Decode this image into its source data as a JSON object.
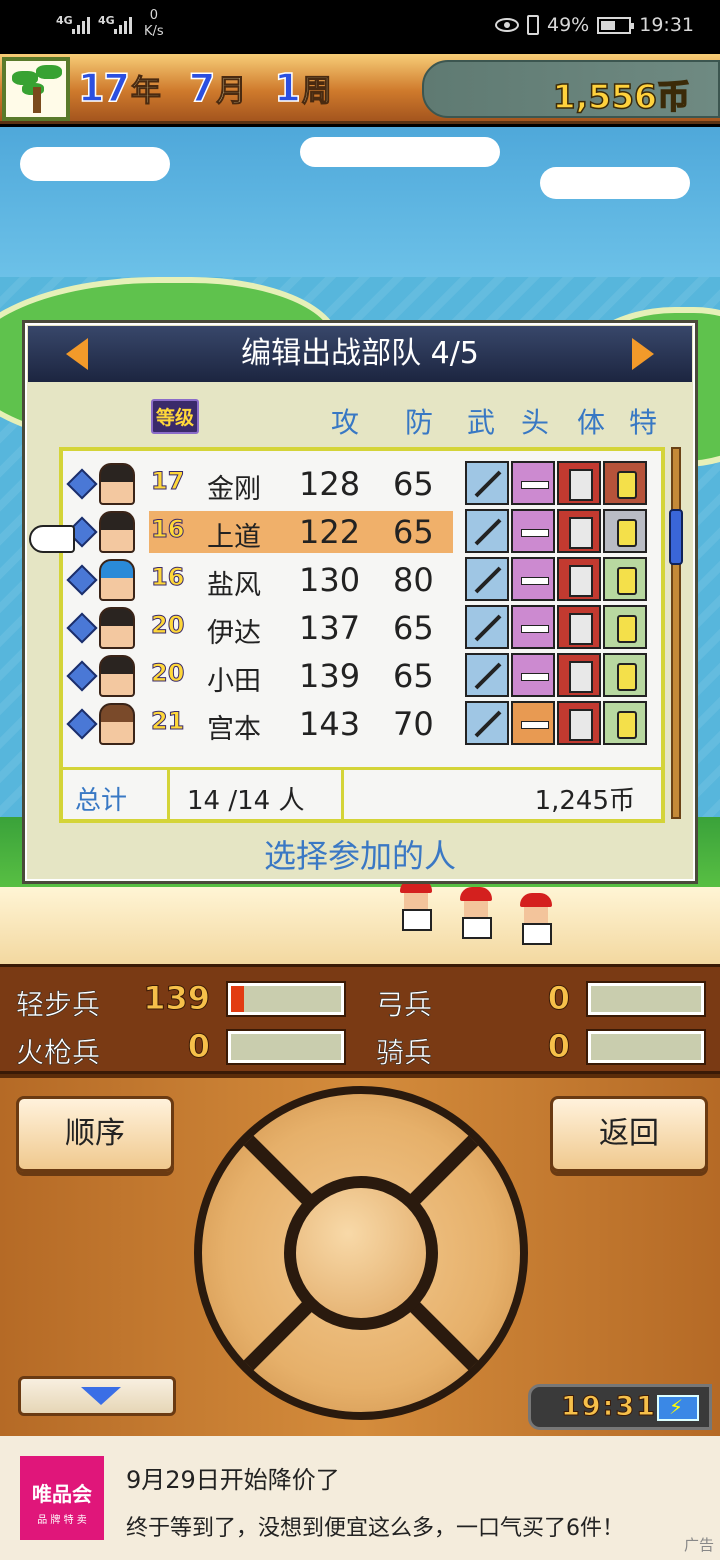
{
  "status_bar": {
    "signal1": "4G",
    "signal2": "4G",
    "net_speed_value": "0",
    "net_speed_unit": "K/s",
    "battery": "49%",
    "time": "19:31"
  },
  "header": {
    "year_num": "17",
    "year_unit": "年",
    "month_num": "7",
    "month_unit": "月",
    "week_num": "1",
    "week_unit": "周",
    "coins": "1,556币"
  },
  "panel": {
    "title": "编辑出战部队 4/5",
    "columns": {
      "level": "等级",
      "attack": "攻",
      "defense": "防",
      "weapon": "武",
      "head": "头",
      "body": "体",
      "special": "特"
    },
    "rows": [
      {
        "level": "17",
        "name": "金刚",
        "attack": "128",
        "defense": "65",
        "special": "horse"
      },
      {
        "level": "16",
        "name": "上道",
        "attack": "122",
        "defense": "65",
        "special": "boar",
        "selected": true
      },
      {
        "level": "16",
        "name": "盐风",
        "attack": "130",
        "defense": "80",
        "special": "potion"
      },
      {
        "level": "20",
        "name": "伊达",
        "attack": "137",
        "defense": "65",
        "special": "potion"
      },
      {
        "level": "20",
        "name": "小田",
        "attack": "139",
        "defense": "65",
        "special": "potion"
      },
      {
        "level": "21",
        "name": "宫本",
        "attack": "143",
        "defense": "70",
        "special": "potion"
      }
    ],
    "totals": {
      "label": "总计",
      "count": "14  /14 人",
      "coins": "1,245币"
    },
    "hint": "选择参加的人"
  },
  "troops": [
    {
      "name": "轻步兵",
      "value": "139",
      "fill": 0.12
    },
    {
      "name": "弓兵",
      "value": "0",
      "fill": 0
    },
    {
      "name": "火枪兵",
      "value": "0",
      "fill": 0
    },
    {
      "name": "骑兵",
      "value": "0",
      "fill": 0
    }
  ],
  "controls": {
    "order": "顺序",
    "back": "返回",
    "clock": "19:31"
  },
  "ad": {
    "logo_big": "唯品会",
    "logo_small": "品 牌 特 卖",
    "title": "9月29日开始降价了",
    "body": "终于等到了，没想到便宜这么多，一口气买了6件！",
    "tag": "广告"
  }
}
